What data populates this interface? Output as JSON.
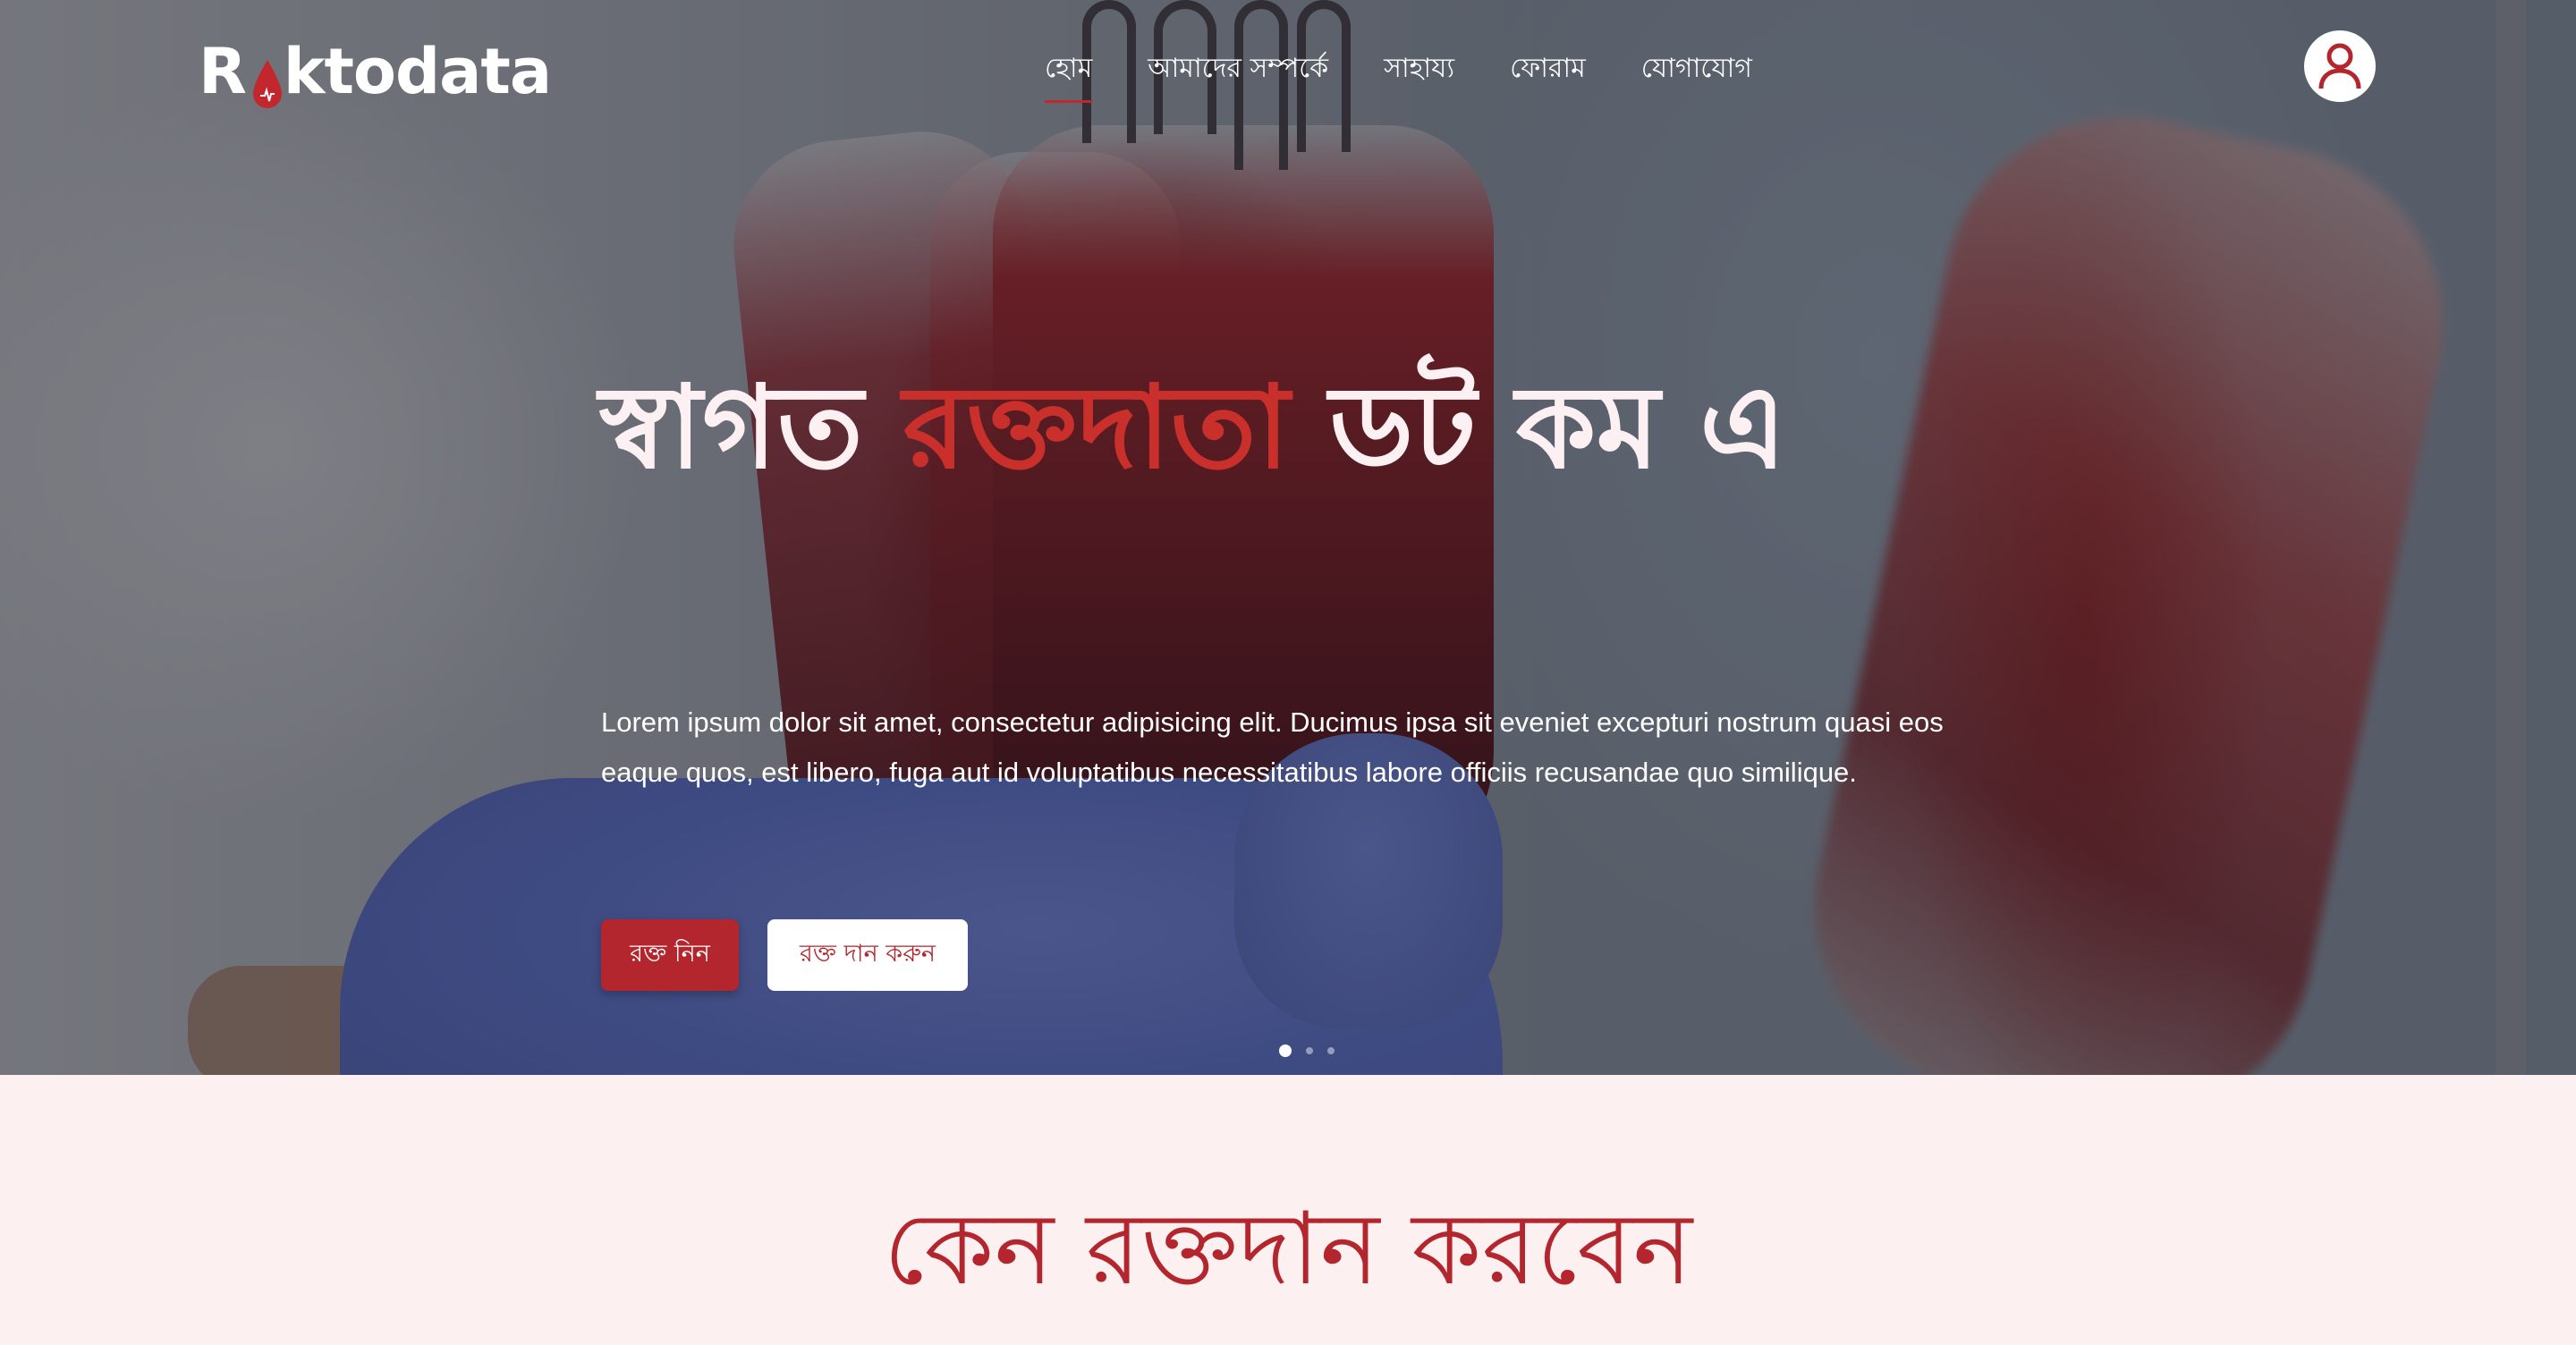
{
  "brand": {
    "name_prefix": "R",
    "name_suffix": "ktodata",
    "logo_icon": "blood-drop-icon",
    "accent_color": "#b3262d"
  },
  "nav": {
    "items": [
      {
        "label": "হোম",
        "active": true
      },
      {
        "label": "আমাদের সম্পর্কে",
        "active": false
      },
      {
        "label": "সাহায্য",
        "active": false
      },
      {
        "label": "ফোরাম",
        "active": false
      },
      {
        "label": "যোগাযোগ",
        "active": false
      }
    ],
    "account_icon": "user-icon"
  },
  "hero": {
    "title_start": "স্বাগত ",
    "title_accent": "রক্তদাতা",
    "title_end": " ডট কম এ",
    "description": "Lorem ipsum dolor sit amet, consectetur adipisicing elit. Ducimus ipsa sit eveniet excepturi nostrum quasi eos eaque quos, est libero, fuga aut id voluptatibus necessitatibus labore officiis recusandae quo similique.",
    "primary_button": "রক্ত নিন",
    "secondary_button": "রক্ত দান করুন",
    "slides": 3,
    "active_slide": 1
  },
  "section": {
    "title": "কেন রক্তদান করবেন"
  }
}
